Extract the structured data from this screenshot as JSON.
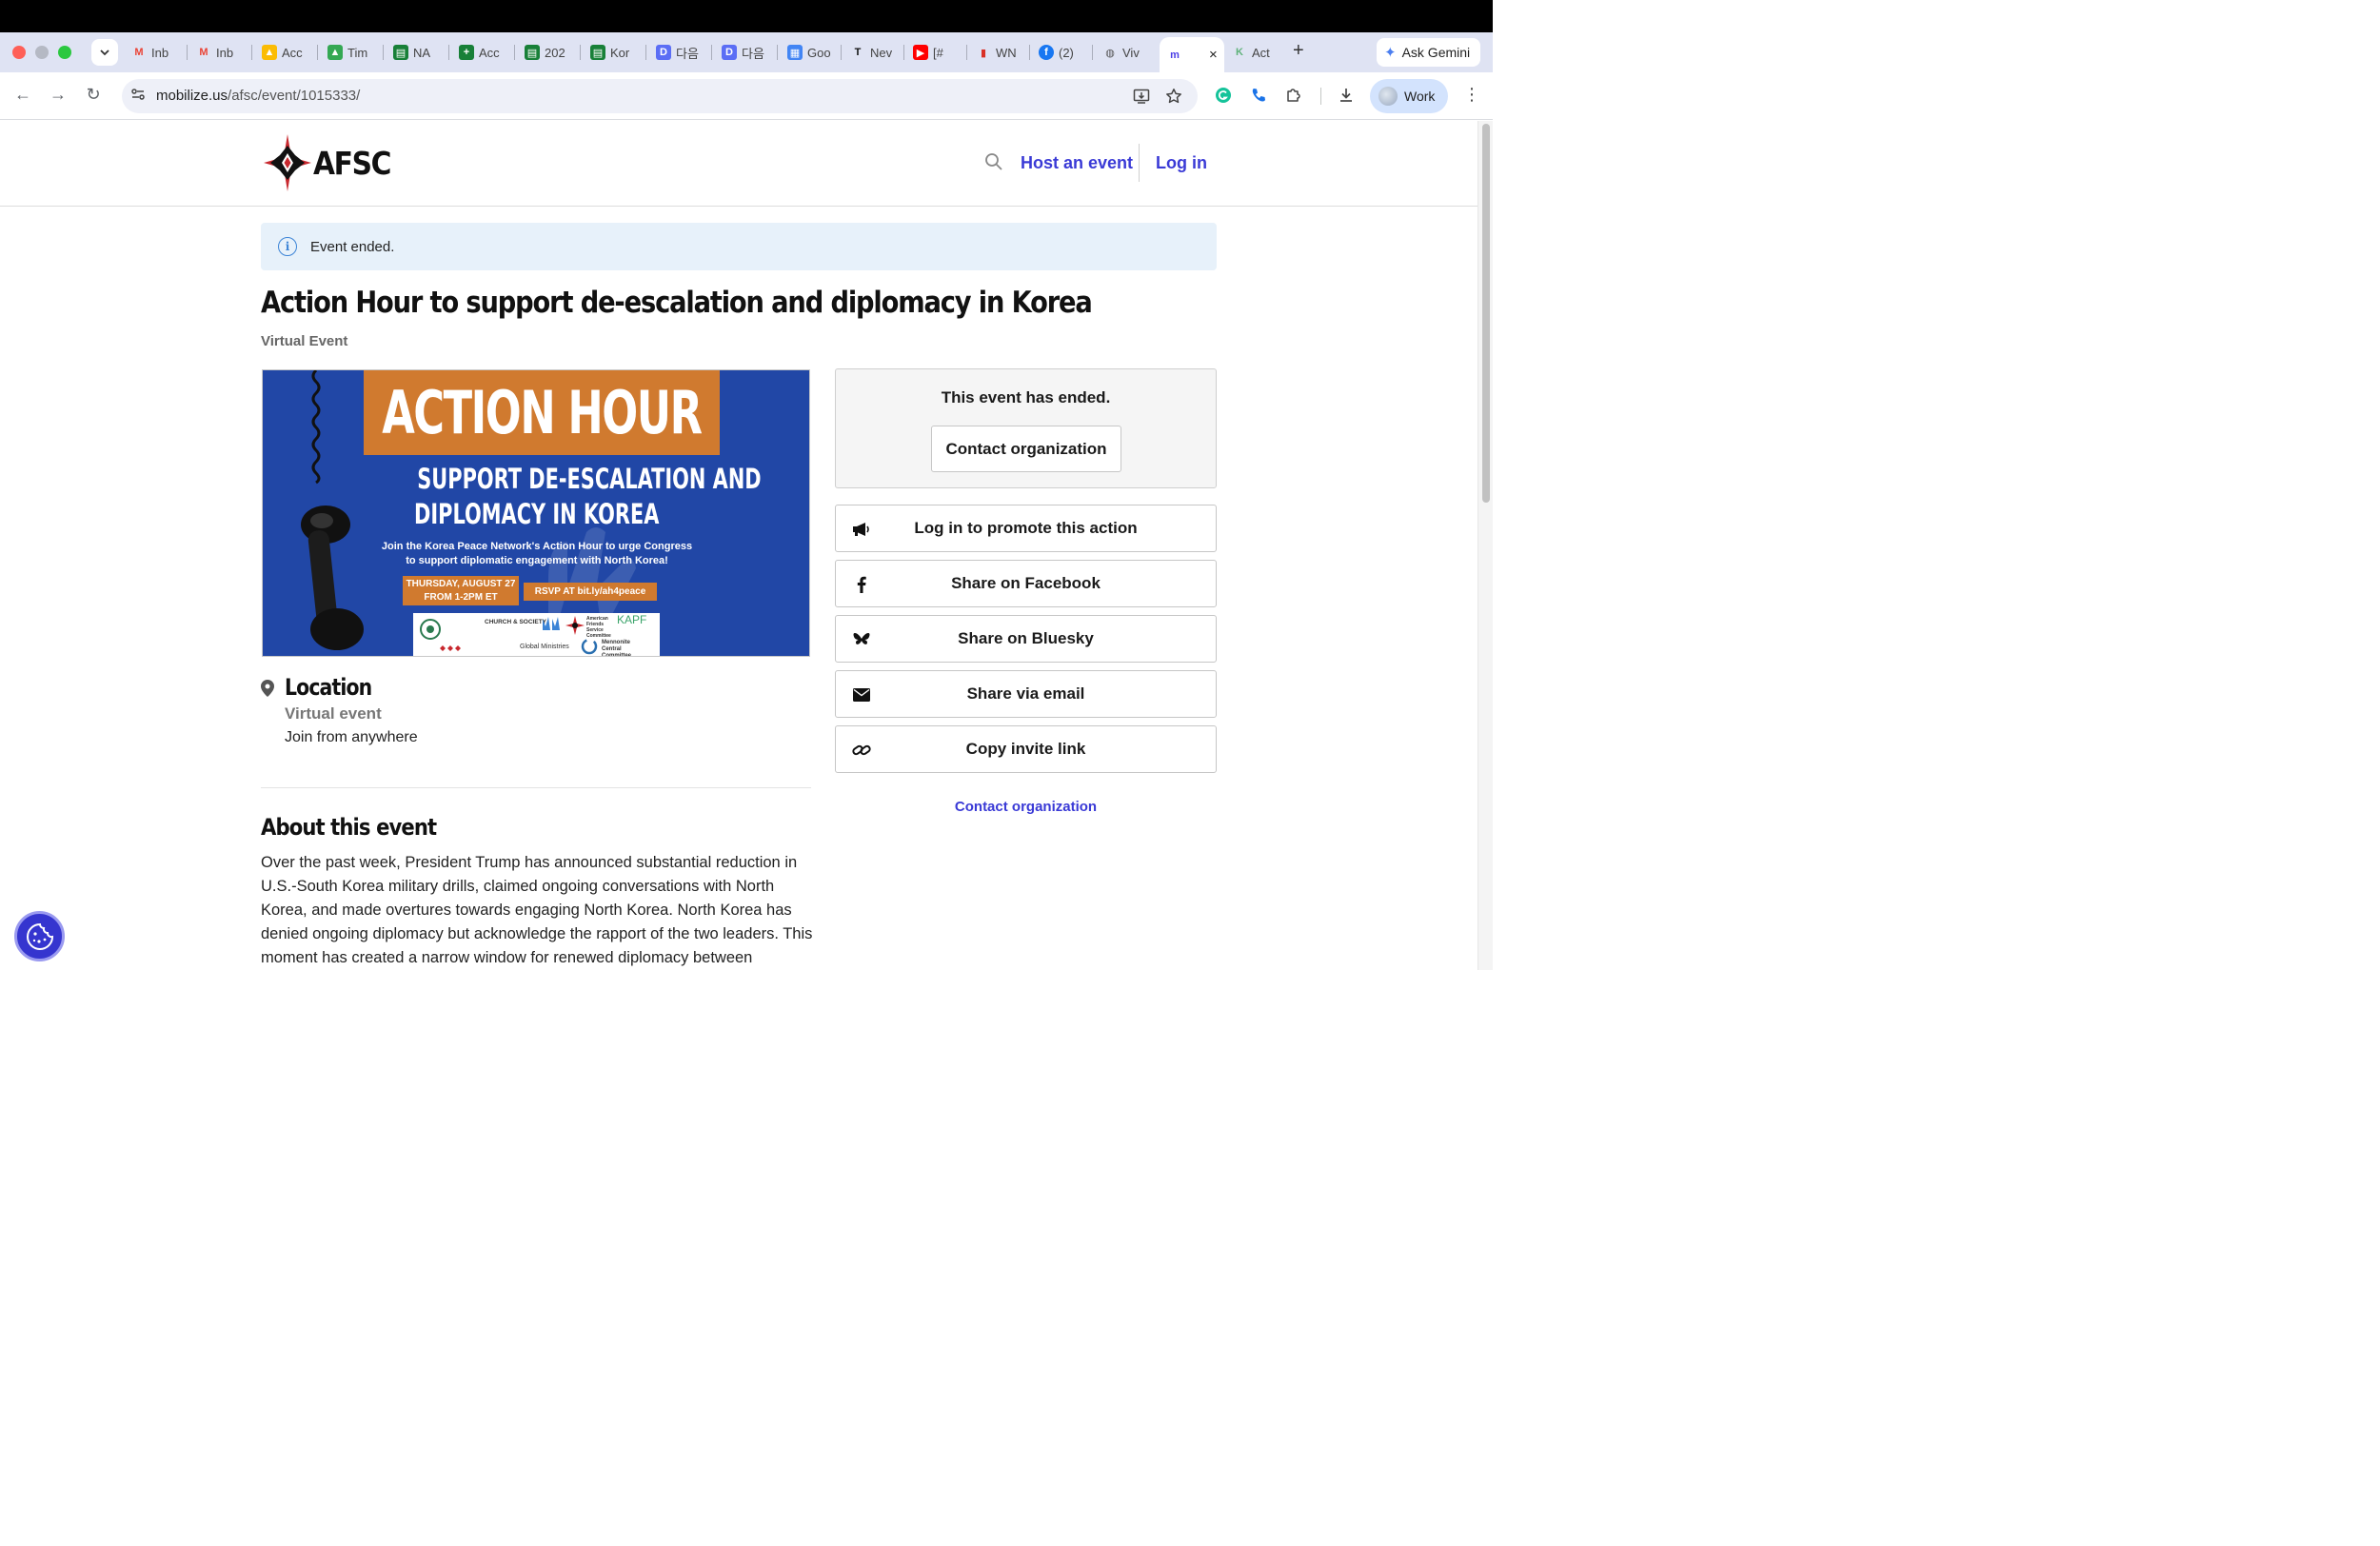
{
  "browser": {
    "tabs": [
      {
        "label": "Inb",
        "favicon": "gmail-icon",
        "color": "#ea4335"
      },
      {
        "label": "Inb",
        "favicon": "gmail-icon",
        "color": "#ea4335"
      },
      {
        "label": "Acc",
        "favicon": "google-drive-icon",
        "color": "#fbbc04"
      },
      {
        "label": "Tim",
        "favicon": "google-drive-icon",
        "color": "#34a853"
      },
      {
        "label": "NA",
        "favicon": "google-sheets-icon",
        "color": "#188038"
      },
      {
        "label": "Acc",
        "favicon": "google-sheets-plus-icon",
        "color": "#188038"
      },
      {
        "label": "202",
        "favicon": "google-sheets-icon",
        "color": "#188038"
      },
      {
        "label": "Kor",
        "favicon": "google-sheets-icon",
        "color": "#188038"
      },
      {
        "label": "다음",
        "favicon": "daum-icon",
        "color": "#5b6ef5"
      },
      {
        "label": "다음",
        "favicon": "daum-icon",
        "color": "#5b6ef5"
      },
      {
        "label": "Goo",
        "favicon": "google-forms-icon",
        "color": "#4285f4"
      },
      {
        "label": "Nev",
        "favicon": "nyt-icon",
        "color": "#111111"
      },
      {
        "label": "[#",
        "favicon": "youtube-icon",
        "color": "#ff0000"
      },
      {
        "label": "WN",
        "favicon": "bar-chart-icon",
        "color": "#d93025"
      },
      {
        "label": "(2)",
        "favicon": "facebook-icon",
        "color": "#1877f2"
      },
      {
        "label": "Viv",
        "favicon": "globe-icon",
        "color": "#555555"
      },
      {
        "label": "",
        "favicon": "mobilize-icon",
        "color": "#4b3ee6",
        "active": true
      },
      {
        "label": "Act",
        "favicon": "kapf-icon",
        "color": "#5fb27a"
      }
    ],
    "active_tab_close": "×",
    "new_tab": "+",
    "gemini_label": "Ask Gemini",
    "url_host": "mobilize.us",
    "url_path": "/afsc/event/1015333/",
    "profile_label": "Work"
  },
  "header": {
    "logo_text": "AFSC",
    "host_event": "Host an event",
    "log_in": "Log in"
  },
  "banner": {
    "text": "Event ended."
  },
  "event": {
    "title": "Action Hour to support de-escalation and diplomacy in Korea",
    "type": "Virtual Event"
  },
  "flyer": {
    "headline": "ACTION HOUR",
    "subline1": "SUPPORT DE-ESCALATION AND",
    "subline2": "DIPLOMACY IN KOREA",
    "body1": "Join the Korea Peace Network's Action Hour to urge Congress",
    "body2": "to support diplomatic engagement with North Korea!",
    "date1": "THURSDAY, AUGUST 27",
    "date2": "FROM 1-2PM ET",
    "rsvp": "RSVP AT bit.ly/ah4peace",
    "sponsors": [
      "CHURCH & SOCIETY",
      "Global Ministries",
      "American Friends Service Committee",
      "KAPF",
      "Mennonite Central Committee"
    ]
  },
  "location": {
    "heading": "Location",
    "type": "Virtual event",
    "where": "Join from anywhere"
  },
  "about": {
    "heading": "About this event",
    "text": "Over the past week, President Trump has announced substantial reduction in U.S.-South Korea military drills, claimed ongoing conversations with North Korea, and made overtures towards engaging North Korea. North Korea has denied ongoing diplomacy but acknowledge the rapport of the two leaders. This moment has created a narrow window for renewed diplomacy between"
  },
  "sidebar": {
    "ended_message": "This event has ended.",
    "contact_button": "Contact organization",
    "actions": [
      {
        "label": "Log in to promote this action",
        "icon": "megaphone-icon"
      },
      {
        "label": "Share on Facebook",
        "icon": "facebook-icon"
      },
      {
        "label": "Share on Bluesky",
        "icon": "bluesky-icon"
      },
      {
        "label": "Share via email",
        "icon": "envelope-icon"
      },
      {
        "label": "Copy invite link",
        "icon": "link-icon"
      }
    ],
    "contact_link": "Contact organization"
  },
  "colors": {
    "link": "#3a3ad6",
    "banner_bg": "#e7f1fa",
    "flyer_blue": "#2147a6",
    "flyer_orange": "#d07a2f",
    "logo_red": "#c8282e",
    "cookie_button": "#3535cf"
  }
}
